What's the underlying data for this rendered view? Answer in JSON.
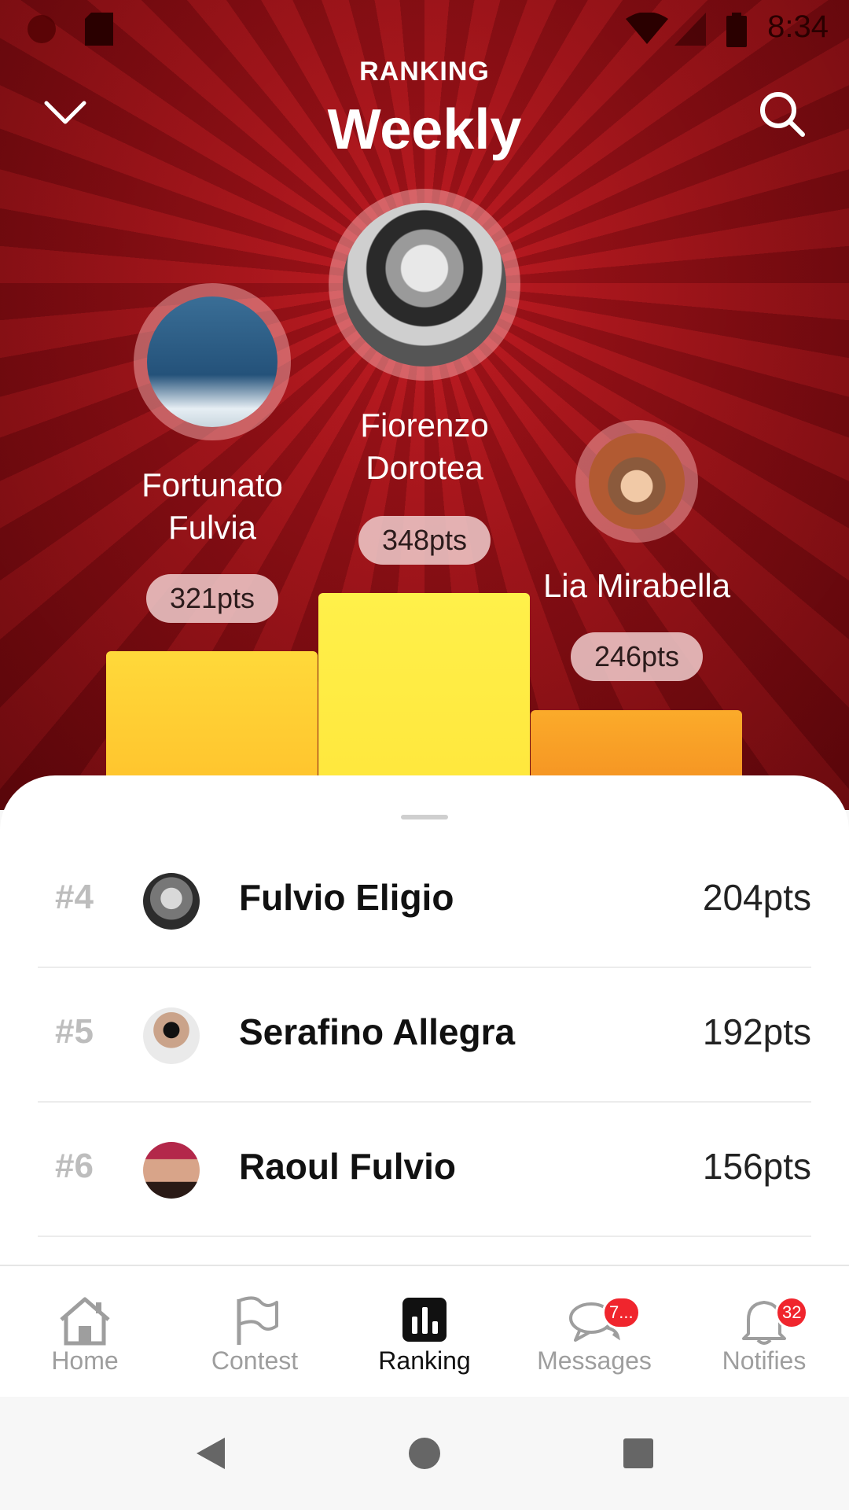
{
  "status_bar": {
    "time": "8:34"
  },
  "header": {
    "subtitle": "RANKING",
    "title": "Weekly"
  },
  "podium": [
    {
      "place": 2,
      "name": "Fortunato\nFulvia",
      "points": "321pts"
    },
    {
      "place": 1,
      "name": "Fiorenzo\nDorotea",
      "points": "348pts"
    },
    {
      "place": 3,
      "name": "Lia Mirabella",
      "points": "246pts"
    }
  ],
  "ranking_list": [
    {
      "rank": "#4",
      "name": "Fulvio Eligio",
      "points": "204pts"
    },
    {
      "rank": "#5",
      "name": "Serafino Allegra",
      "points": "192pts"
    },
    {
      "rank": "#6",
      "name": "Raoul Fulvio",
      "points": "156pts"
    }
  ],
  "bottom_nav": {
    "tabs": [
      {
        "label": "Home",
        "icon": "home-icon",
        "active": false
      },
      {
        "label": "Contest",
        "icon": "flag-icon",
        "active": false
      },
      {
        "label": "Ranking",
        "icon": "bar-chart-icon",
        "active": true
      },
      {
        "label": "Messages",
        "icon": "chat-icon",
        "active": false,
        "badge": "7..."
      },
      {
        "label": "Notifies",
        "icon": "bell-icon",
        "active": false,
        "badge": "32"
      }
    ]
  },
  "colors": {
    "hero_red": "#9a0d15",
    "first_bar": "#ffeb3b",
    "second_bar": "#ffc928",
    "third_bar": "#f79a22",
    "badge": "#f0252d"
  }
}
